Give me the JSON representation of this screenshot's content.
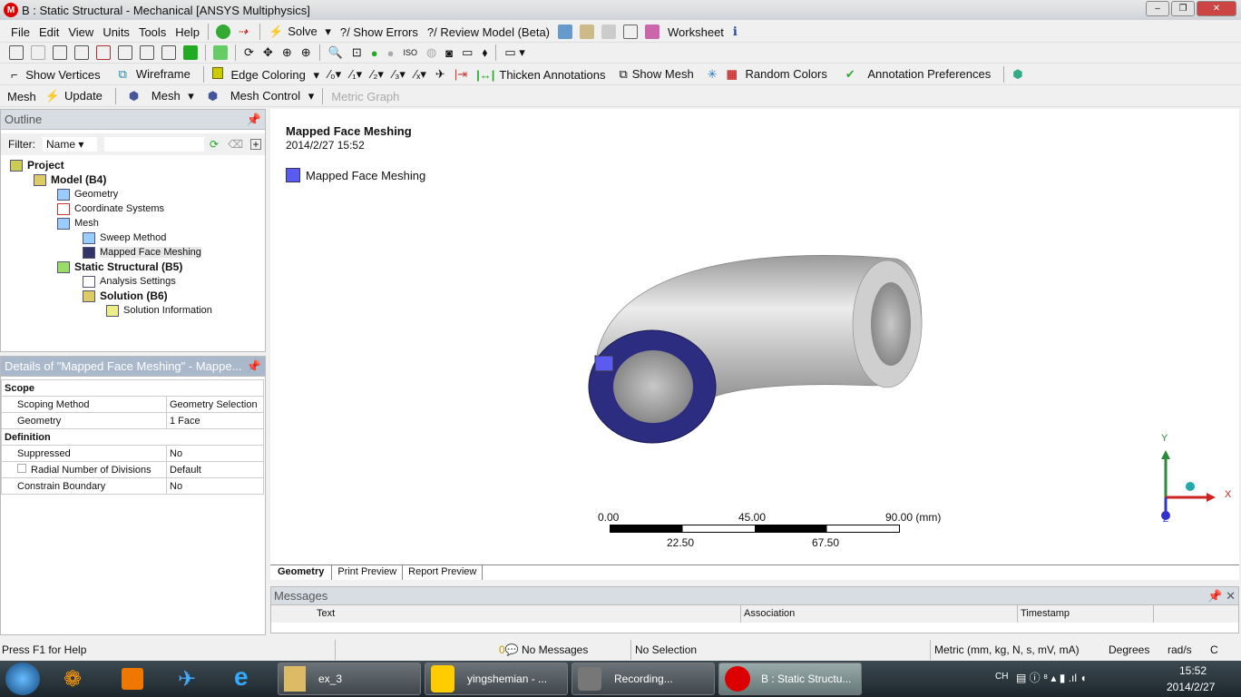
{
  "window": {
    "title": "B : Static Structural - Mechanical [ANSYS Multiphysics]",
    "logo": "M"
  },
  "menu": {
    "items": [
      "File",
      "Edit",
      "View",
      "Units",
      "Tools",
      "Help"
    ],
    "solve": "Solve",
    "show_errors": "?/ Show Errors",
    "review_model": "?/ Review Model (Beta)",
    "worksheet": "Worksheet"
  },
  "toolbar3": {
    "show_vertices": "Show Vertices",
    "wireframe": "Wireframe",
    "edge_coloring": "Edge Coloring",
    "thicken": "Thicken Annotations",
    "show_mesh": "Show Mesh",
    "random_colors": "Random Colors",
    "annotation_prefs": "Annotation Preferences"
  },
  "toolbar4": {
    "mesh_label": "Mesh",
    "update": "Update",
    "mesh": "Mesh",
    "mesh_control": "Mesh Control",
    "metric_graph": "Metric Graph"
  },
  "outline": {
    "title": "Outline",
    "filter_label": "Filter:",
    "filter_value": "Name",
    "filter_text": "",
    "tree": [
      {
        "label": "Project"
      },
      {
        "label": "Model (B4)"
      },
      {
        "label": "Geometry"
      },
      {
        "label": "Coordinate Systems"
      },
      {
        "label": "Mesh"
      },
      {
        "label": "Sweep Method"
      },
      {
        "label": "Mapped Face Meshing"
      },
      {
        "label": "Static Structural (B5)"
      },
      {
        "label": "Analysis Settings"
      },
      {
        "label": "Solution (B6)"
      },
      {
        "label": "Solution Information"
      }
    ]
  },
  "details": {
    "title": "Details of \"Mapped Face Meshing\" - Mappe...",
    "rows": [
      {
        "group": "Scope"
      },
      {
        "k": "Scoping Method",
        "v": "Geometry Selection"
      },
      {
        "k": "Geometry",
        "v": "1 Face"
      },
      {
        "group": "Definition"
      },
      {
        "k": "Suppressed",
        "v": "No"
      },
      {
        "k": "Radial Number of Divisions",
        "v": "Default"
      },
      {
        "k": "Constrain Boundary",
        "v": "No"
      }
    ]
  },
  "viewport": {
    "title": "Mapped Face Meshing",
    "date": "2014/2/27 15:52",
    "legend": "Mapped Face Meshing",
    "legend_color": "#5b5bef",
    "scale": {
      "top": [
        "0.00",
        "45.00",
        "90.00 (mm)"
      ],
      "bottom": [
        "22.50",
        "67.50"
      ]
    },
    "axes": {
      "x": "X",
      "y": "Y",
      "z": "Z"
    },
    "tabs": [
      "Geometry",
      "Print Preview",
      "Report Preview"
    ]
  },
  "messages": {
    "title": "Messages",
    "columns": [
      "Text",
      "Association",
      "Timestamp"
    ]
  },
  "status": {
    "help": "Press F1 for Help",
    "messages": "No Messages",
    "messages_count": "0",
    "selection": "No Selection",
    "units": "Metric (mm, kg, N, s, mV, mA)",
    "angle": "Degrees",
    "rot": "rad/s",
    "temp": "C"
  },
  "taskbar": {
    "buttons": [
      "ex_3",
      "yingshemian - ...",
      "Recording...",
      "B : Static Structu..."
    ],
    "lang": "CH",
    "time": "15:52",
    "date": "2014/2/27"
  }
}
